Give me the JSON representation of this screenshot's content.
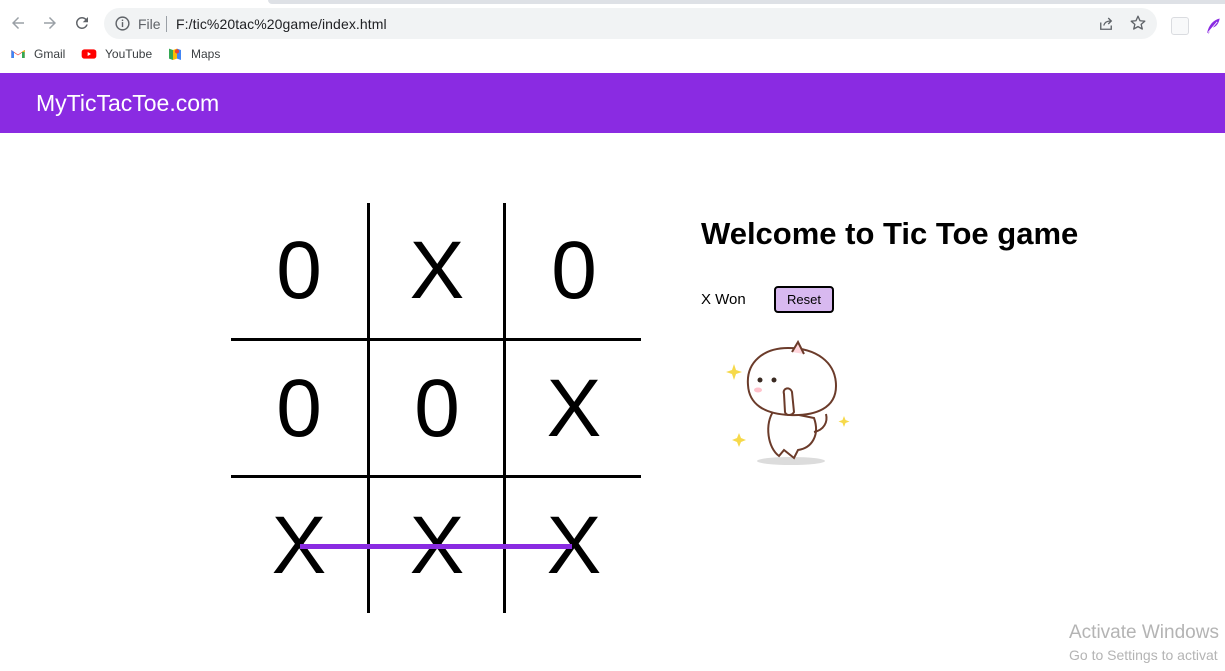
{
  "browser": {
    "scheme_label": "File",
    "url": "F:/tic%20tac%20game/index.html",
    "bookmarks": [
      {
        "label": "Gmail",
        "icon": "gmail-icon"
      },
      {
        "label": "YouTube",
        "icon": "youtube-icon"
      },
      {
        "label": "Maps",
        "icon": "maps-icon"
      }
    ]
  },
  "site": {
    "brand": "MyTicTacToe.com",
    "accent_color": "#8a2be2"
  },
  "game": {
    "title": "Welcome to Tic Toe game",
    "status": "X Won",
    "reset_label": "Reset",
    "board": [
      [
        "0",
        "X",
        "0"
      ],
      [
        "0",
        "0",
        "X"
      ],
      [
        "X",
        "X",
        "X"
      ]
    ],
    "winning_row": 3,
    "celebration_image": "dancing-cat-sticker"
  },
  "watermark": {
    "line1": "Activate Windows",
    "line2": "Go to Settings to activat"
  }
}
